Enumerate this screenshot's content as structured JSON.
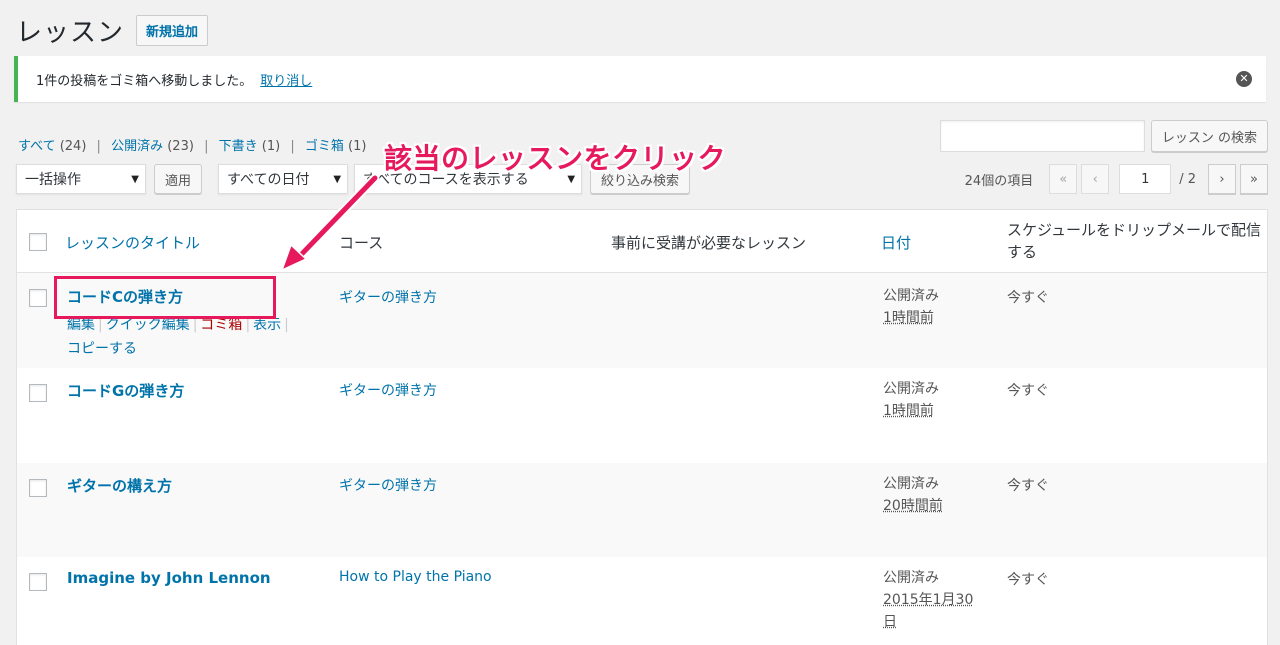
{
  "header": {
    "title": "レッスン",
    "add_new": "新規追加"
  },
  "notice": {
    "message": "1件の投稿をゴミ箱へ移動しました。",
    "undo": "取り消し",
    "dismiss_icon": "dismiss-icon"
  },
  "filters": {
    "all": "すべて",
    "all_count": "(24)",
    "published": "公開済み",
    "published_count": "(23)",
    "draft": "下書き",
    "draft_count": "(1)",
    "trash": "ゴミ箱",
    "trash_count": "(1)"
  },
  "search": {
    "button": "レッスン の検索",
    "value": ""
  },
  "tablenav": {
    "bulk_action": "一括操作",
    "apply": "適用",
    "date_filter": "すべての日付",
    "course_filter": "すべてのコースを表示する",
    "filter_button": "絞り込み検索"
  },
  "pagination": {
    "items": "24個の項目",
    "first": "«",
    "prev": "‹",
    "current": "1",
    "total": "/ 2",
    "next": "›",
    "last": "»"
  },
  "columns": {
    "title": "レッスンのタイトル",
    "course": "コース",
    "prereq": "事前に受講が必要なレッスン",
    "date": "日付",
    "schedule": "スケジュールをドリップメールで配信する"
  },
  "rows": [
    {
      "title": "コードCの弾き方",
      "course": "ギターの弾き方",
      "status": "公開済み",
      "date": "1時間前",
      "schedule": "今すぐ"
    },
    {
      "title": "コードGの弾き方",
      "course": "ギターの弾き方",
      "status": "公開済み",
      "date": "1時間前",
      "schedule": "今すぐ"
    },
    {
      "title": "ギターの構え方",
      "course": "ギターの弾き方",
      "status": "公開済み",
      "date": "20時間前",
      "schedule": "今すぐ"
    },
    {
      "title": "Imagine by John Lennon",
      "course": "How to Play the Piano",
      "status": "公開済み",
      "date_line1": "2015年1月30",
      "date_line2": "日",
      "schedule": "今すぐ"
    }
  ],
  "row_actions": {
    "edit": "編集",
    "quick_edit": "クイック編集",
    "trash": "ゴミ箱",
    "view": "表示",
    "copy": "コピーする"
  },
  "annotation": {
    "text": "該当のレッスンをクリック",
    "color": "#e6195d"
  }
}
